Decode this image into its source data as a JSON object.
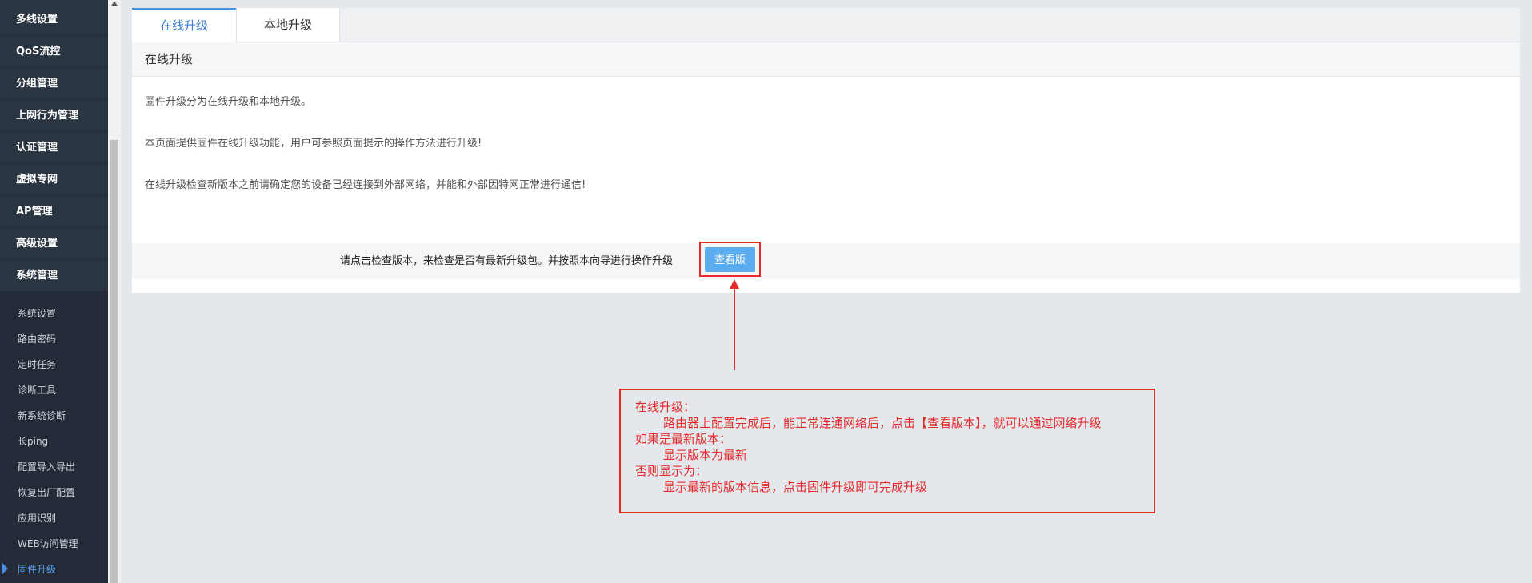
{
  "sidebar": {
    "menu": [
      {
        "label": "多线设置"
      },
      {
        "label": "QoS流控"
      },
      {
        "label": "分组管理"
      },
      {
        "label": "上网行为管理"
      },
      {
        "label": "认证管理"
      },
      {
        "label": "虚拟专网"
      },
      {
        "label": "AP管理"
      },
      {
        "label": "高级设置"
      },
      {
        "label": "系统管理"
      }
    ],
    "submenu": [
      {
        "label": "系统设置"
      },
      {
        "label": "路由密码"
      },
      {
        "label": "定时任务"
      },
      {
        "label": "诊断工具"
      },
      {
        "label": "新系统诊断"
      },
      {
        "label": "长ping"
      },
      {
        "label": "配置导入导出"
      },
      {
        "label": "恢复出厂配置"
      },
      {
        "label": "应用识别"
      },
      {
        "label": "WEB访问管理"
      },
      {
        "label": "固件升级"
      }
    ]
  },
  "tabs": [
    {
      "label": "在线升级"
    },
    {
      "label": "本地升级"
    }
  ],
  "section": {
    "title": "在线升级",
    "descriptions": [
      "固件升级分为在线升级和本地升级。",
      "本页面提供固件在线升级功能，用户可参照页面提示的操作方法进行升级!",
      "在线升级检查新版本之前请确定您的设备已经连接到外部网络，并能和外部因特网正常进行通信!"
    ],
    "prompt": "请点击检查版本，来检查是否有最新升级包。并按照本向导进行操作升级",
    "check_button": "查看版本"
  },
  "annotation": {
    "lines": [
      "在线升级：",
      "路由器上配置完成后，能正常连通网络后，点击【查看版本】，就可以通过网络升级",
      "如果是最新版本：",
      "显示版本为最新",
      "否则显示为：",
      "显示最新的版本信息，点击固件升级即可完成升级"
    ],
    "color": "#e52a2a"
  }
}
